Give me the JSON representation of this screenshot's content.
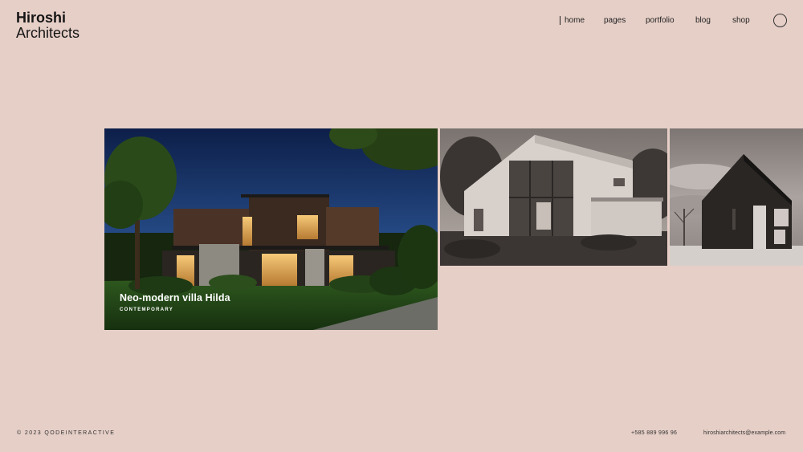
{
  "brand": {
    "line1": "Hiroshi",
    "line2": "Architects"
  },
  "nav": {
    "items": [
      "home",
      "pages",
      "portfolio",
      "blog",
      "shop"
    ],
    "active_index": 0
  },
  "search": {
    "icon": "search-circle-icon"
  },
  "slider": {
    "slides": [
      {
        "title": "Neo-modern villa Hilda",
        "category": "CONTEMPORARY",
        "image": "night-villa-photo"
      },
      {
        "image": "grayscale-modern-house-photo"
      },
      {
        "image": "grayscale-dark-gable-house-photo"
      }
    ]
  },
  "footer": {
    "copyright": "© 2023 QODEINTERACTIVE",
    "phone": "+585 889 996 96",
    "email": "hiroshiarchitects@example.com"
  },
  "colors": {
    "background": "#e6cfc7",
    "text": "#1a1a1a"
  }
}
